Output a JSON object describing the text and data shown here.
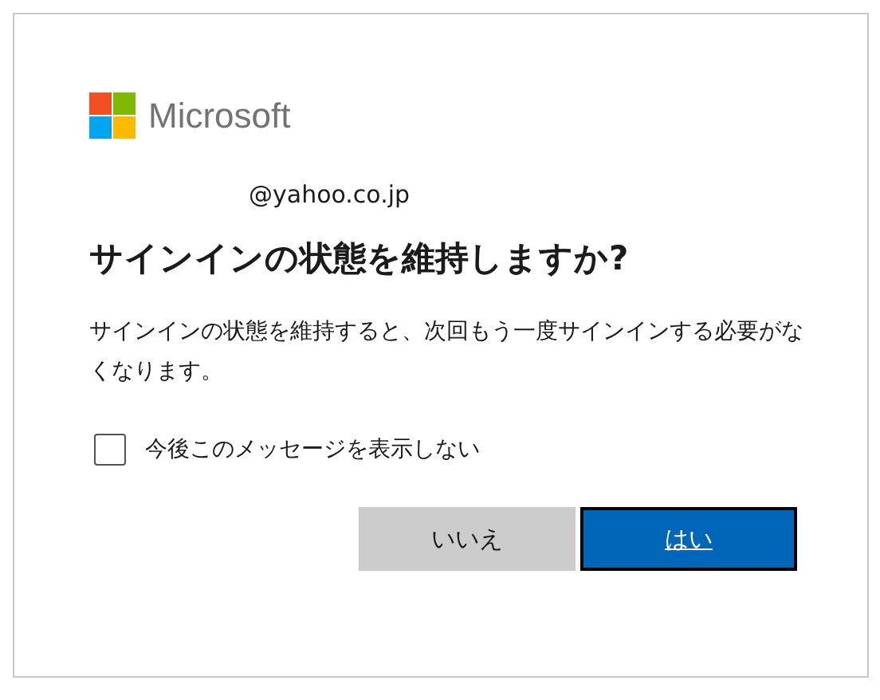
{
  "logo": {
    "text": "Microsoft"
  },
  "account": "@yahoo.co.jp",
  "heading": "サインインの状態を維持しますか?",
  "description": "サインインの状態を維持すると、次回もう一度サインインする必要がなくなります。",
  "checkbox": {
    "label": "今後このメッセージを表示しない",
    "checked": false
  },
  "buttons": [
    {
      "label": "いいえ",
      "kind": "secondary",
      "focused": false
    },
    {
      "label": "はい",
      "kind": "primary",
      "focused": true
    }
  ]
}
